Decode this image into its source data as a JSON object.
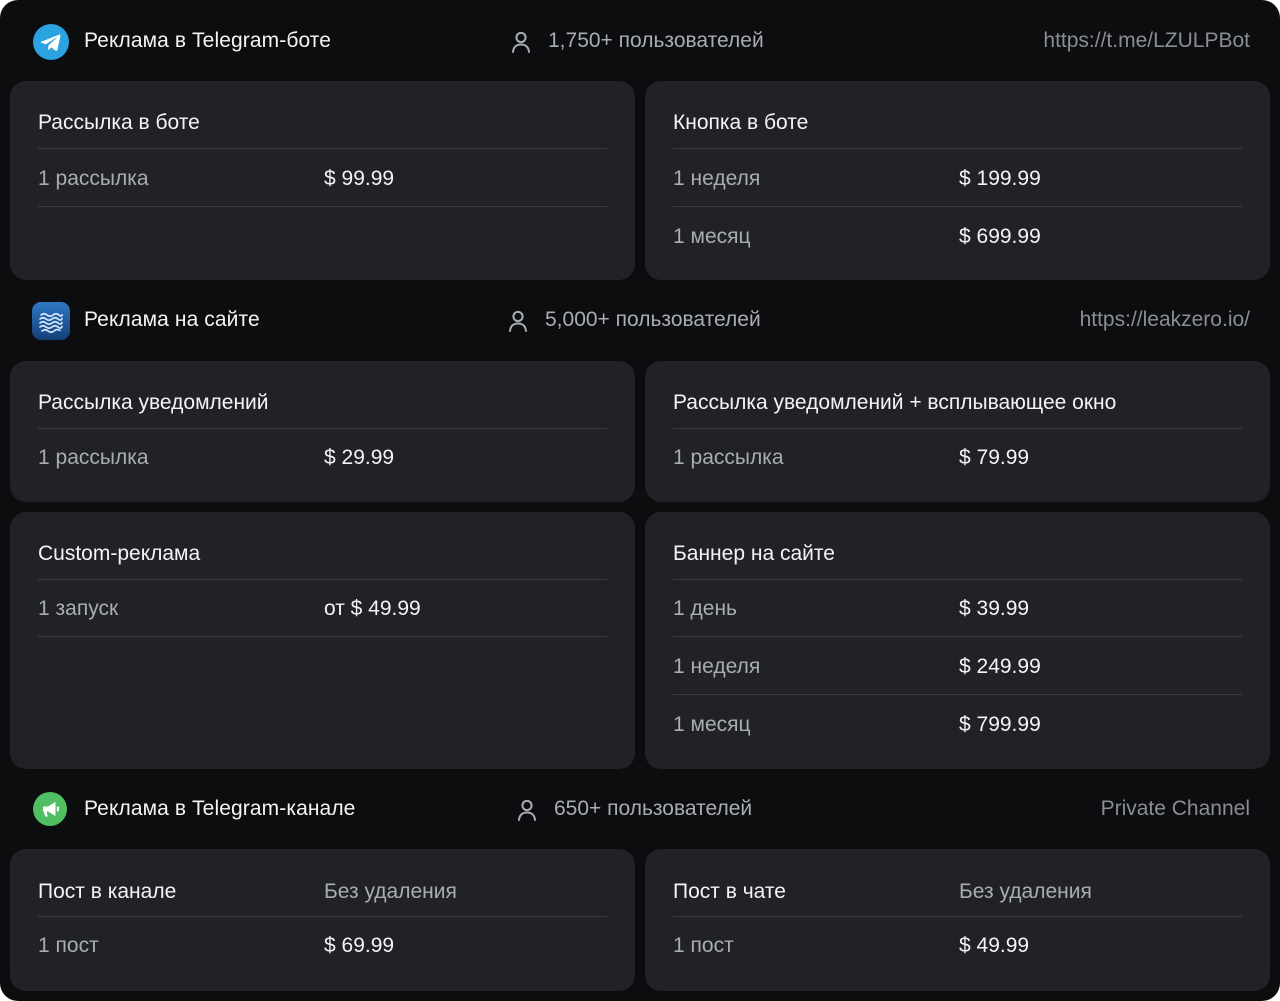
{
  "colors": {
    "background": "#0c0d0f",
    "card": "#202226",
    "divider": "#3a3d42",
    "text_primary": "#f3f4f6",
    "text_secondary": "#a9acb2",
    "link": "#8a8d93",
    "telegram_blue": "#2aa3e0",
    "site_blue": "#1f5aa0",
    "channel_green": "#4fbf62"
  },
  "sections": [
    {
      "icon": "telegram-icon",
      "title": "Реклама в Telegram-боте",
      "users": "1,750+ пользователей",
      "link": "https://t.me/LZULPBot",
      "cards": [
        {
          "title": "Рассылка в боте",
          "rows": [
            {
              "label": "1 рассылка",
              "price": "$ 99.99"
            }
          ]
        },
        {
          "title": "Кнопка в боте",
          "rows": [
            {
              "label": "1 неделя",
              "price": "$ 199.99"
            },
            {
              "label": "1 месяц",
              "price": "$ 699.99"
            }
          ]
        }
      ]
    },
    {
      "icon": "waves-icon",
      "title": "Реклама на сайте",
      "users": "5,000+ пользователей",
      "link": "https://leakzero.io/",
      "cards": [
        {
          "title": "Рассылка уведомлений",
          "rows": [
            {
              "label": "1 рассылка",
              "price": "$ 29.99"
            }
          ]
        },
        {
          "title": "Рассылка уведомлений + всплывающее окно",
          "rows": [
            {
              "label": "1 рассылка",
              "price": "$ 79.99"
            }
          ]
        },
        {
          "title": "Custom-реклама",
          "rows": [
            {
              "label": "1 запуск",
              "price": "от $ 49.99"
            }
          ]
        },
        {
          "title": "Баннер на сайте",
          "rows": [
            {
              "label": "1 день",
              "price": "$ 39.99"
            },
            {
              "label": "1 неделя",
              "price": "$ 249.99"
            },
            {
              "label": "1 месяц",
              "price": "$ 799.99"
            }
          ]
        }
      ]
    },
    {
      "icon": "megaphone-icon",
      "title": "Реклама в Telegram-канале",
      "users": "650+ пользователей",
      "link": "Private Channel",
      "cards": [
        {
          "title": "Пост в канале",
          "subtitle": "Без удаления",
          "rows": [
            {
              "label": "1 пост",
              "price": "$ 69.99"
            }
          ]
        },
        {
          "title": "Пост в чате",
          "subtitle": "Без удаления",
          "rows": [
            {
              "label": "1 пост",
              "price": "$ 49.99"
            }
          ]
        }
      ]
    }
  ]
}
